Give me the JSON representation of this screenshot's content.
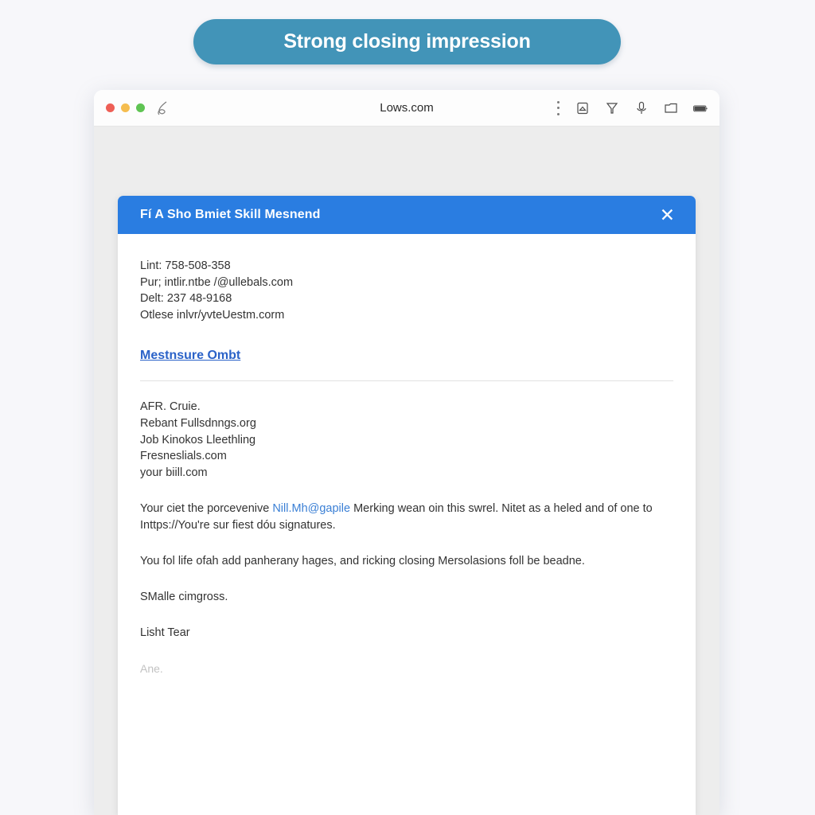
{
  "banner": {
    "label": "Strong closing impression",
    "color": "#4294b8"
  },
  "browser": {
    "title": "Lows.com",
    "traffic_lights": [
      "close-red",
      "minimize-yellow",
      "maximize-green"
    ],
    "left_icon": "scribble-icon",
    "right_icons": [
      "vertical-dots-icon",
      "image-box-icon",
      "funnel-icon",
      "microphone-icon",
      "folder-icon",
      "battery-icon"
    ]
  },
  "dialog": {
    "title": "Fí A Sho Bmiet Skill Mesnend",
    "close_label": "✕",
    "header_color": "#2a7de1",
    "contact": [
      "Lint:  758-508-358",
      "Pur; intlir.ntbe /@ullebals.com",
      "Delt: 237 48-9168",
      "Otlese inlvr/yvteUestm.corm"
    ],
    "section_link": "Mestnsure Ombt",
    "list_lines": [
      "AFR. Cruie.",
      "Rebant Fullsdnngs.org",
      "Job Kinokos Lleethling",
      "Fresneslials.com",
      "your biill.com"
    ],
    "paragraph_1": {
      "before": "Your ciet the porcevenive ",
      "link": "Nill.Mh@gapile",
      "after": " Merking wean oin this swrel. Nitet as a heled and of one to Inttps://You're sur fiest dóu signatures."
    },
    "paragraph_2": "You fol life ofah add panherany hages, and ricking closing Mersolasions foll be beadne.",
    "closing": "SMalle cimgross.",
    "signature": "Lisht Tear",
    "faint_note": "Ane."
  }
}
